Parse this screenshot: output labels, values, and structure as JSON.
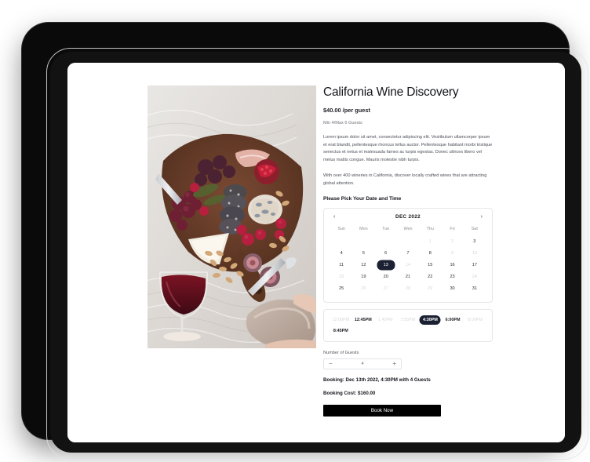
{
  "device": {
    "type": "tablet-mockup"
  },
  "product": {
    "title": "California Wine Discovery",
    "price": "$40.00 /per guest",
    "capacity": "Min 4/Max 6 Guests",
    "description_1": "Lorem ipsum dolor sit amet, consectetur adipiscing elit. Vestibulum ullamcorper ipsum et erat blandit, pellentesque rhoncus tellus auctor. Pellentesque habitant morbi tristique senectus et netus et malesuada fames ac turpis egestas. Donec ultrices libero vel metus mattis congue. Mauris molestie nibh turpis.",
    "description_2": "With over 400 wineries in California, discover locally crafted wines that are attracting global attention.",
    "photo_alt": "charcuterie-board-with-wine-glass-and-slippers"
  },
  "picker": {
    "heading": "Please Pick Your Date and Time"
  },
  "calendar": {
    "prev_label": "‹",
    "next_label": "›",
    "month": "DEC 2022",
    "weekdays": [
      "Sun",
      "Mon",
      "Tue",
      "Wen",
      "Thu",
      "Fri",
      "Sat"
    ],
    "leading_blanks": 4,
    "days": [
      {
        "n": "1",
        "state": "disabled"
      },
      {
        "n": "2",
        "state": "disabled"
      },
      {
        "n": "3",
        "state": "available"
      },
      {
        "n": "4",
        "state": "available"
      },
      {
        "n": "5",
        "state": "available"
      },
      {
        "n": "6",
        "state": "available"
      },
      {
        "n": "7",
        "state": "available"
      },
      {
        "n": "8",
        "state": "available"
      },
      {
        "n": "9",
        "state": "disabled"
      },
      {
        "n": "10",
        "state": "disabled"
      },
      {
        "n": "11",
        "state": "available"
      },
      {
        "n": "12",
        "state": "available"
      },
      {
        "n": "13",
        "state": "selected"
      },
      {
        "n": "14",
        "state": "disabled"
      },
      {
        "n": "15",
        "state": "available"
      },
      {
        "n": "16",
        "state": "available"
      },
      {
        "n": "17",
        "state": "available"
      },
      {
        "n": "18",
        "state": "disabled"
      },
      {
        "n": "19",
        "state": "available"
      },
      {
        "n": "20",
        "state": "available"
      },
      {
        "n": "21",
        "state": "available"
      },
      {
        "n": "22",
        "state": "available"
      },
      {
        "n": "23",
        "state": "available"
      },
      {
        "n": "24",
        "state": "disabled"
      },
      {
        "n": "25",
        "state": "available"
      },
      {
        "n": "26",
        "state": "disabled"
      },
      {
        "n": "27",
        "state": "disabled"
      },
      {
        "n": "28",
        "state": "disabled"
      },
      {
        "n": "29",
        "state": "disabled"
      },
      {
        "n": "30",
        "state": "available"
      },
      {
        "n": "31",
        "state": "available"
      }
    ],
    "selected_day": "13"
  },
  "timeslots": {
    "slots": [
      {
        "label": "12:00PM",
        "state": "disabled"
      },
      {
        "label": "12:45PM",
        "state": "available"
      },
      {
        "label": "1:45PM",
        "state": "disabled"
      },
      {
        "label": "2:55PM",
        "state": "disabled"
      },
      {
        "label": "4:30PM",
        "state": "selected"
      },
      {
        "label": "6:00PM",
        "state": "available"
      },
      {
        "label": "8:00PM",
        "state": "disabled"
      },
      {
        "label": "8:45PM",
        "state": "available"
      }
    ],
    "selected": "4:30PM"
  },
  "guests": {
    "label": "Number of Guests",
    "decrement_label": "−",
    "value": "4",
    "increment_label": "+"
  },
  "summary": {
    "booking": "Booking: Dec 13th 2022, 4:30PM with 4 Guests",
    "cost": "Booking Cost: $160.00"
  },
  "cta": {
    "book_now_label": "Book Now"
  },
  "colors": {
    "accent_dark": "#1b2133",
    "button_black": "#000000",
    "text_primary": "#14151a",
    "text_muted": "#6e7177",
    "disabled": "#d6d8dc",
    "border": "#e6e7ea"
  }
}
